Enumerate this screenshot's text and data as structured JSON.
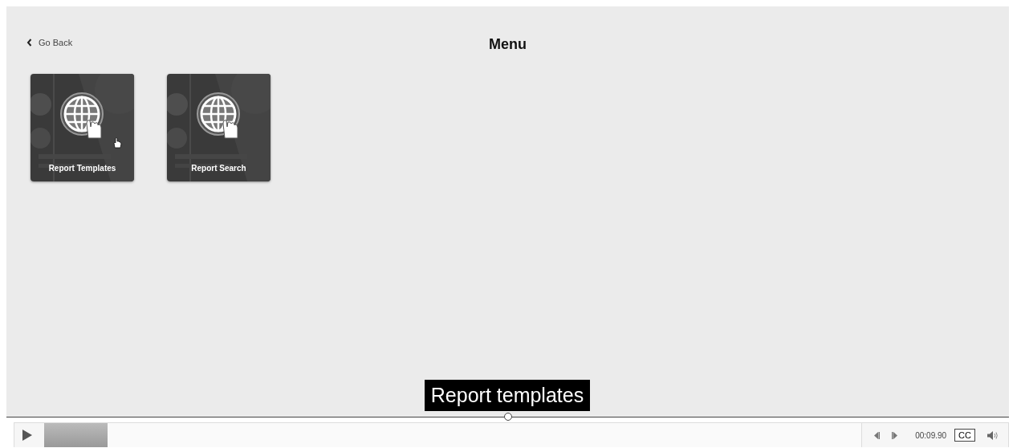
{
  "header": {
    "back_link": "Go Back",
    "title": "Menu"
  },
  "tiles": [
    {
      "label": "Report Templates",
      "hovered": true
    },
    {
      "label": "Report Search",
      "hovered": false
    }
  ],
  "caption": "Report templates",
  "timeline": {
    "level": 0.5
  },
  "player": {
    "playing": false,
    "progress": {
      "level": 0.078
    },
    "time": "00:09.90",
    "cc": "CC"
  }
}
